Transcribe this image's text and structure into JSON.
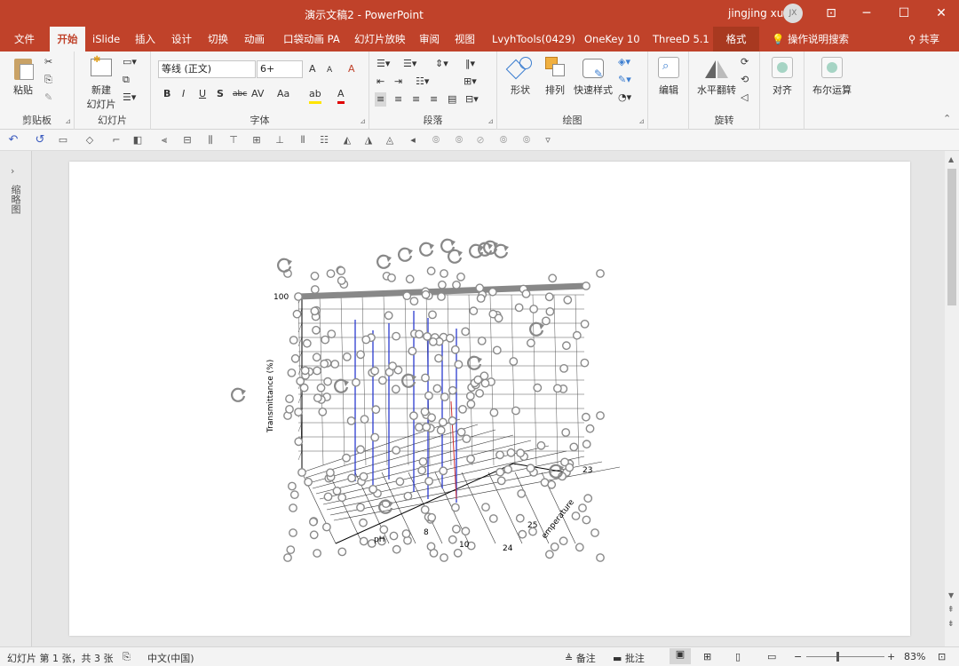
{
  "titlebar": {
    "doc_title": "演示文稿2  -  PowerPoint",
    "user": "jingjing xu",
    "avatar_initials": "JX",
    "minimize": "─",
    "maximize": "☐",
    "close": "✕",
    "ribbon_display": "⊡"
  },
  "menu": {
    "tabs": [
      "文件",
      "开始",
      "iSlide",
      "插入",
      "设计",
      "切换",
      "动画",
      "口袋动画 PA",
      "幻灯片放映",
      "审阅",
      "视图",
      "LvyhTools(0429)",
      "OneKey 10",
      "ThreeD 5.1",
      "格式"
    ],
    "search": "操作说明搜索",
    "share": "共享"
  },
  "ribbon": {
    "clipboard": {
      "paste": "粘贴",
      "label": "剪贴板"
    },
    "slides": {
      "new_slide_line1": "新建",
      "new_slide_line2": "幻灯片",
      "label": "幻灯片"
    },
    "font": {
      "font_name": "等线 (正文)",
      "font_size": "6+",
      "label": "字体",
      "bold": "B",
      "italic": "I",
      "underline": "U",
      "shadow": "S",
      "strike": "abc",
      "spacing": "AV",
      "case": "Aa",
      "grow": "A",
      "shrink": "A",
      "clear": "A",
      "highlight": "ab",
      "color": "A"
    },
    "paragraph": {
      "label": "段落"
    },
    "drawing": {
      "shapes": "形状",
      "arrange": "排列",
      "quick_styles": "快速样式",
      "label": "绘图"
    },
    "editing": {
      "edit": "编辑"
    },
    "rotate": {
      "flip": "水平翻转",
      "label": "旋转"
    },
    "align": {
      "label": "对齐"
    },
    "boolean": {
      "label": "布尔运算"
    }
  },
  "leftpane": {
    "label": "缩略图"
  },
  "chart": {
    "ylabel": "Transmittance (%)",
    "y_tick_top": "100",
    "zlabel": "emperature",
    "ticks": [
      "23",
      "25",
      "24",
      "8",
      "10",
      "pH"
    ]
  },
  "status": {
    "slide_info": "幻灯片 第 1 张，共 3 张",
    "language": "中文(中国)",
    "notes": "备注",
    "comments": "批注",
    "zoom": "83%"
  },
  "colors": {
    "accent": "#c0422a",
    "handle": "#8a8a8a",
    "blue_line": "#2b3bd0",
    "red_line": "#d03030"
  }
}
